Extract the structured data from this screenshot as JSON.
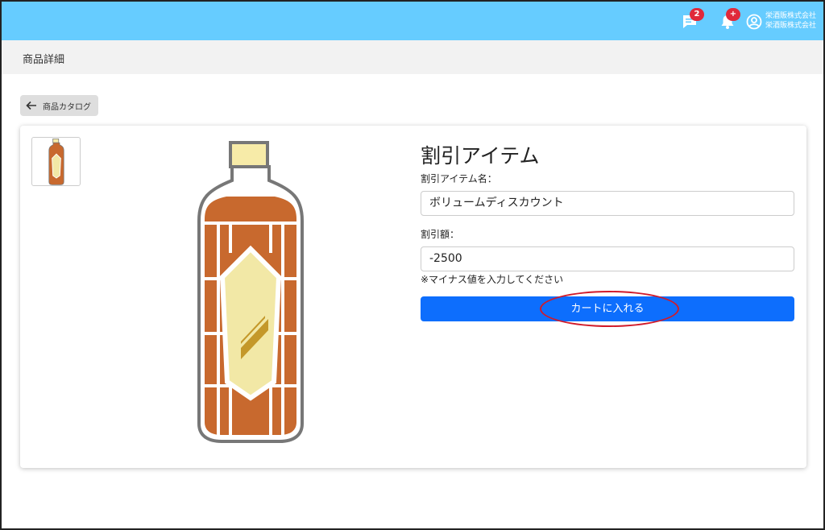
{
  "header": {
    "message_badge": "2",
    "notification_badge": "+",
    "user_line1": "栄酒販株式会社",
    "user_line2": "栄酒販株式会社"
  },
  "subheader": {
    "title": "商品詳細"
  },
  "back_button": {
    "label": "商品カタログ"
  },
  "product": {
    "title": "割引アイテム",
    "name_label": "割引アイテム名：",
    "name_value": "ボリュームディスカウント",
    "amount_label": "割引額：",
    "amount_value": "-2500",
    "hint": "※マイナス値を入力してください",
    "cart_button": "カートに入れる"
  },
  "colors": {
    "header_bg": "#66ccff",
    "primary": "#0d6efd",
    "badge": "#e0293a",
    "annotation": "#d11a2a",
    "bottle_body": "#c8692e",
    "bottle_label": "#f2e8a6",
    "bottle_cap": "#f7eba8"
  },
  "icons": {
    "messages": "chat-icon",
    "notifications": "bell-icon",
    "user": "user-circle-icon",
    "back": "arrow-left-icon"
  }
}
